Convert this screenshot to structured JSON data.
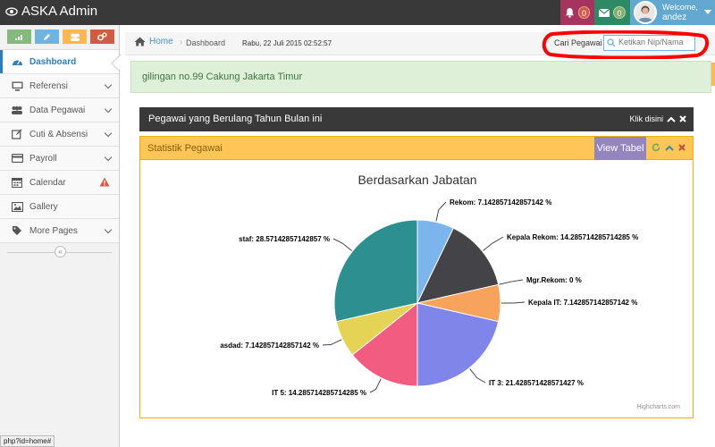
{
  "app": {
    "brand": "ASKA Admin"
  },
  "topbar": {
    "notifications_count": "0",
    "messages_count": "0",
    "welcome": "Welcome,",
    "username": "andez"
  },
  "sidebar": {
    "shortcut_colors": [
      "#87b87f",
      "#6fb3e0",
      "#ffb752",
      "#d15b47"
    ],
    "items": [
      {
        "label": "Dashboard",
        "icon": "dashboard-icon",
        "active": true
      },
      {
        "label": "Referensi",
        "icon": "desktop-icon"
      },
      {
        "label": "Data Pegawai",
        "icon": "users-icon"
      },
      {
        "label": "Cuti & Absensi",
        "icon": "edit-icon"
      },
      {
        "label": "Payroll",
        "icon": "credit-card-icon"
      },
      {
        "label": "Calendar",
        "icon": "calendar-icon",
        "warning": true
      },
      {
        "label": "Gallery",
        "icon": "picture-icon"
      },
      {
        "label": "More Pages",
        "icon": "tag-icon"
      }
    ],
    "collapse_label": "«"
  },
  "breadcrumbs": {
    "home": "Home",
    "current": "Dashboard",
    "date": "Rabu, 22 Juli 2015 02:52:57"
  },
  "search": {
    "label": "Cari Pegawai",
    "placeholder": "Ketikan Nip/Nama"
  },
  "alert": {
    "text": "gilingan no.99 Cakung Jakarta Timur"
  },
  "widget_dark": {
    "title": "Pegawai yang Berulang Tahun Bulan ini",
    "link": "Klik disini"
  },
  "widget_stat": {
    "title": "Statistik Pegawai",
    "view_button": "View Tabel"
  },
  "chart_data": {
    "type": "pie",
    "title": "Berdasarkan Jabatan",
    "credits": "Highcharts.com",
    "slices": [
      {
        "name": "Rekom",
        "value": 7.142857142857142,
        "label": "Rekom: 7.142857142857142 %",
        "color": "#7cb5ec"
      },
      {
        "name": "Kepala Rekom",
        "value": 14.285714285714285,
        "label": "Kepala Rekom: 14.285714285714285 %",
        "color": "#434348"
      },
      {
        "name": "Mgr.Rekom",
        "value": 0,
        "label": "Mgr.Rekom: 0 %",
        "color": "#90ed7d"
      },
      {
        "name": "Kepala IT",
        "value": 7.142857142857142,
        "label": "Kepala IT: 7.142857142857142 %",
        "color": "#f7a35c"
      },
      {
        "name": "IT 3",
        "value": 21.428571428571427,
        "label": "IT 3: 21.428571428571427 %",
        "color": "#8085e9"
      },
      {
        "name": "IT 5",
        "value": 14.285714285714285,
        "label": "IT 5: 14.285714285714285 %",
        "color": "#f15c80"
      },
      {
        "name": "asdad",
        "value": 7.142857142857142,
        "label": "asdad: 7.142857142857142 %",
        "color": "#e4d354"
      },
      {
        "name": "staf",
        "value": 28.57142857142857,
        "label": "staf: 28.57142857142857 %",
        "color": "#2b908f"
      }
    ]
  },
  "statusbar": {
    "url": "php?id=home#"
  }
}
